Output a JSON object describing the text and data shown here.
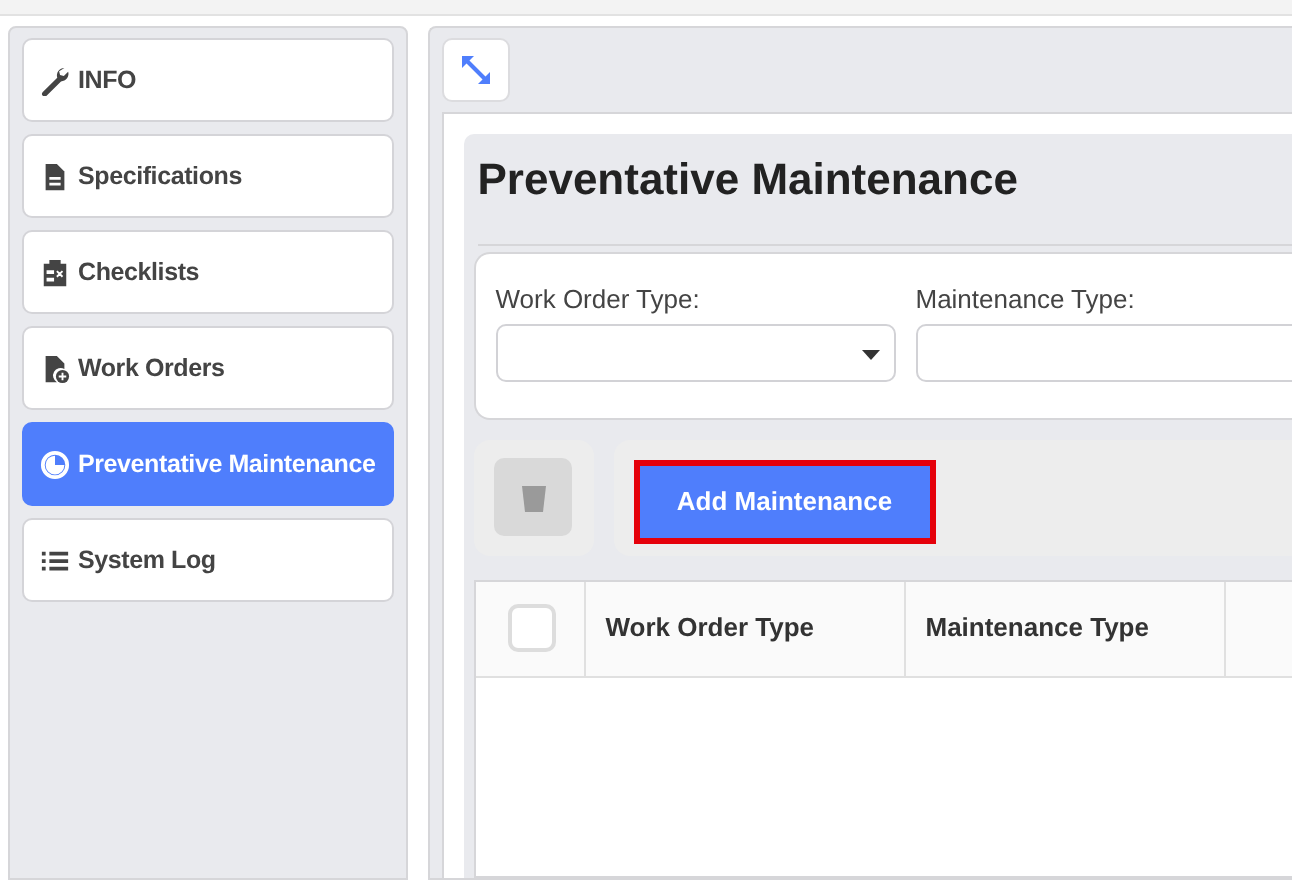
{
  "sidebar": {
    "items": [
      {
        "label": "INFO",
        "selected": false
      },
      {
        "label": "Specifications",
        "selected": false
      },
      {
        "label": "Checklists",
        "selected": false
      },
      {
        "label": "Work Orders",
        "selected": false
      },
      {
        "label": "Preventative Maintenance",
        "selected": true
      },
      {
        "label": "System Log",
        "selected": false
      }
    ]
  },
  "section": {
    "title": "Preventative Maintenance",
    "filters": [
      {
        "label": "Work Order Type:",
        "kind": "select"
      },
      {
        "label": "Maintenance Type:",
        "kind": "text"
      }
    ],
    "toolbar": {
      "delete_disabled": true,
      "add_button": {
        "label": "Add Maintenance",
        "highlighted": true
      }
    },
    "table": {
      "select_all_checked": false,
      "columns": [
        "Work Order Type",
        "Maintenance Type"
      ]
    }
  }
}
